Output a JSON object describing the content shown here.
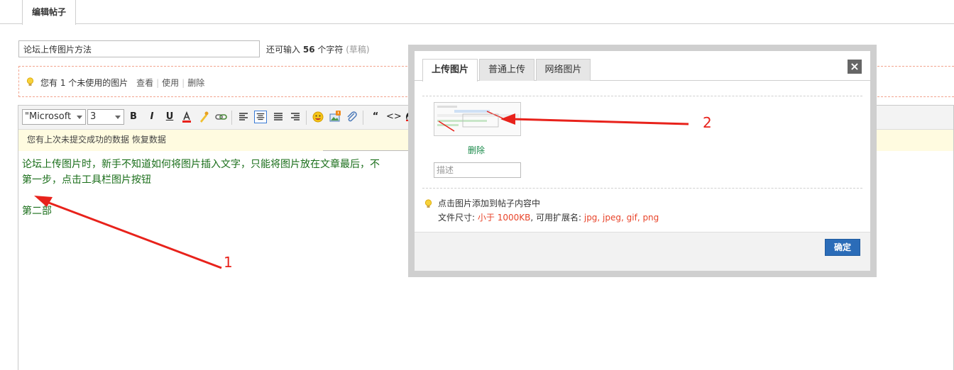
{
  "page_tab": {
    "label": "编辑帖子"
  },
  "title_field": {
    "value": "论坛上传图片方法"
  },
  "char_count": {
    "prefix": "还可输入",
    "count": "56",
    "suffix": "个字符",
    "draft": "(草稿)"
  },
  "unused_notice": {
    "text": "您有 1 个未使用的图片",
    "view": "查看",
    "use": "使用",
    "delete": "删除",
    "sep": "|"
  },
  "toolbar": {
    "font_family": "\"Microsoft",
    "font_size": "3",
    "bold": "B",
    "italic": "I",
    "underline": "U",
    "quote": "“",
    "code": "<>"
  },
  "restore_bar": {
    "text": "您有上次未提交成功的数据 恢复数据"
  },
  "content": {
    "line1": "论坛上传图片时，新手不知道如何将图片插入文字，只能将图片放在文章最后，不",
    "line2": "第一步，点击工具栏图片按钮",
    "line3": "第二部"
  },
  "dialog": {
    "tabs": [
      "上传图片",
      "普通上传",
      "网络图片"
    ],
    "close": "×",
    "delete_label": "删除",
    "desc_placeholder": "描述",
    "tip1": "点击图片添加到帖子内容中",
    "tip2_prefix": "文件尺寸:",
    "tip2_size": "小于 1000KB",
    "tip2_mid": ", 可用扩展名:",
    "tip2_ext": "jpg, jpeg, gif, png",
    "ok": "确定"
  },
  "annotations": {
    "arrow1_label": "1",
    "arrow2_label": "2",
    "color": "#e8221b"
  },
  "colors": {
    "accent_blue": "#2b6cb8",
    "link_green": "#1a8a4a",
    "highlight_red": "#e8442a",
    "content_green": "#1a6e1a"
  }
}
